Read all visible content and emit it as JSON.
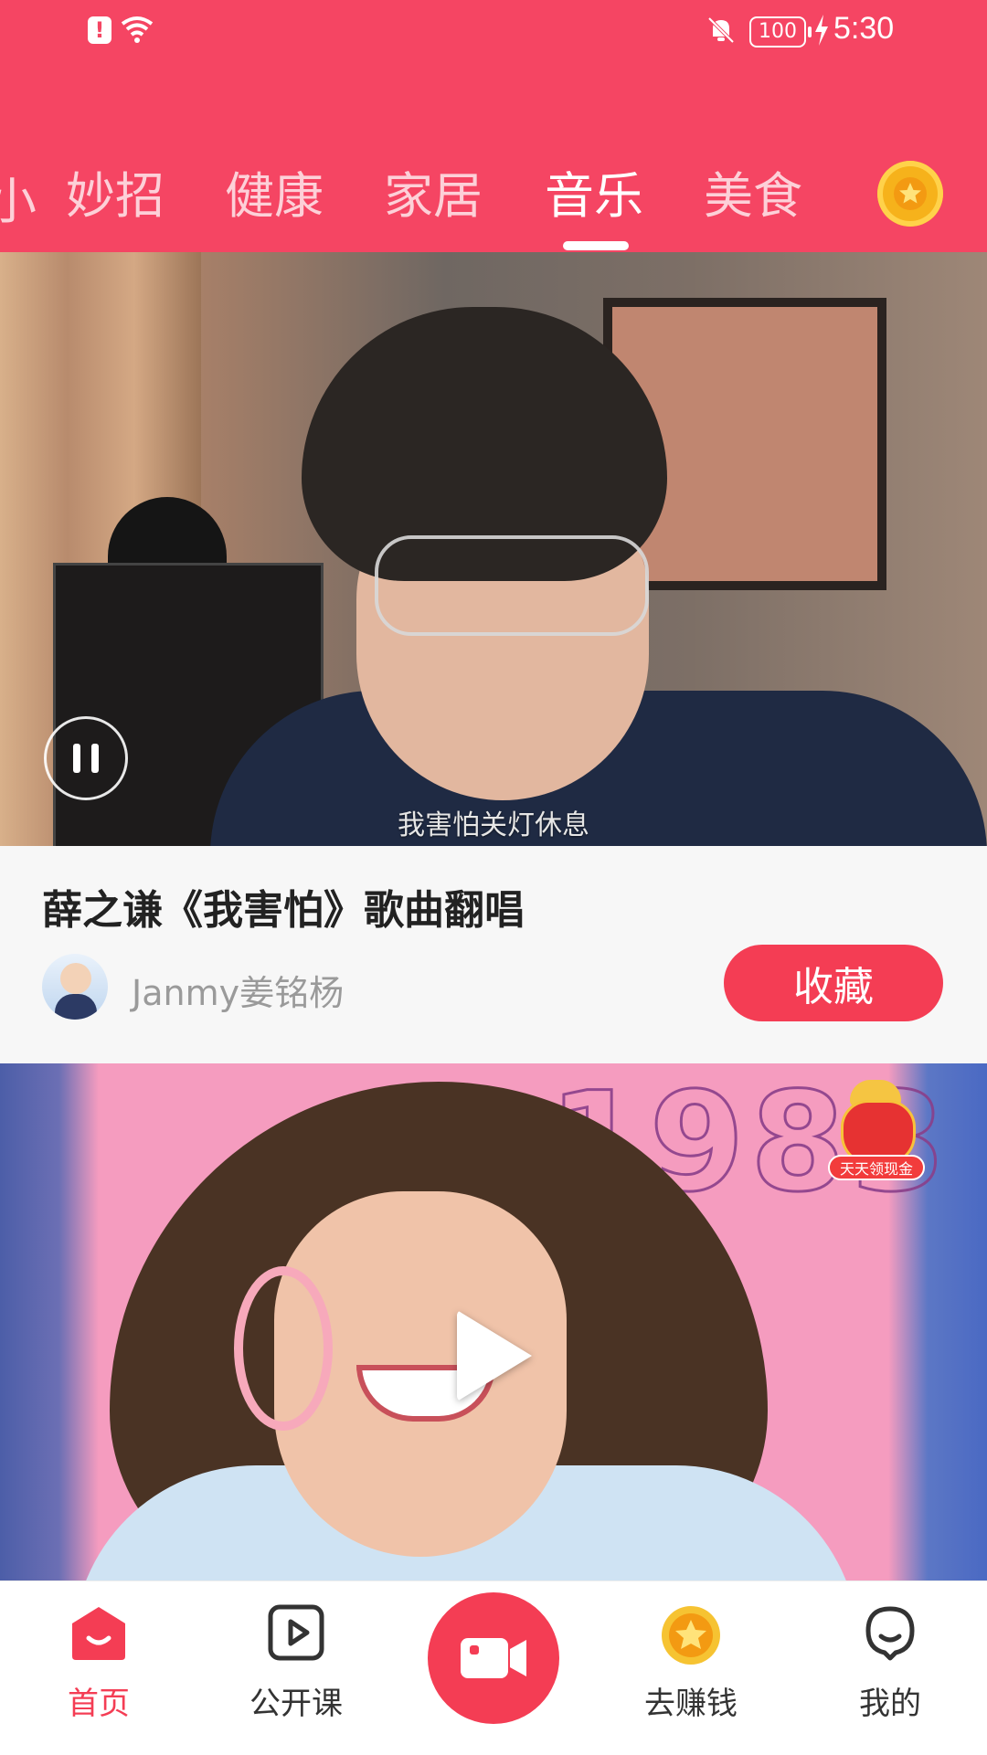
{
  "status_bar": {
    "battery": "100",
    "time": "5:30"
  },
  "tabs": {
    "partial_left": "小",
    "items": [
      {
        "label": "妙招"
      },
      {
        "label": "健康"
      },
      {
        "label": "家居"
      },
      {
        "label": "音乐",
        "active": true
      },
      {
        "label": "美食"
      }
    ],
    "coin_icon": "coin-star-icon"
  },
  "video1": {
    "subtitle": "我害怕关灯休息",
    "control": "pause"
  },
  "card": {
    "title": "薛之谦《我害怕》歌曲翻唱",
    "author": "Janmy姜铭杨",
    "favorite_label": "收藏"
  },
  "video2": {
    "year_text": "1983",
    "reward_label": "天天领现金",
    "control": "play"
  },
  "bottom_nav": {
    "items": [
      {
        "label": "首页",
        "active": true,
        "icon": "home-icon"
      },
      {
        "label": "公开课",
        "icon": "play-square-icon"
      },
      {
        "label": "",
        "icon": "camera-icon"
      },
      {
        "label": "去赚钱",
        "icon": "coin-icon"
      },
      {
        "label": "我的",
        "icon": "profile-icon"
      }
    ]
  },
  "colors": {
    "brand": "#f54563",
    "accent_button": "#f43d54"
  }
}
